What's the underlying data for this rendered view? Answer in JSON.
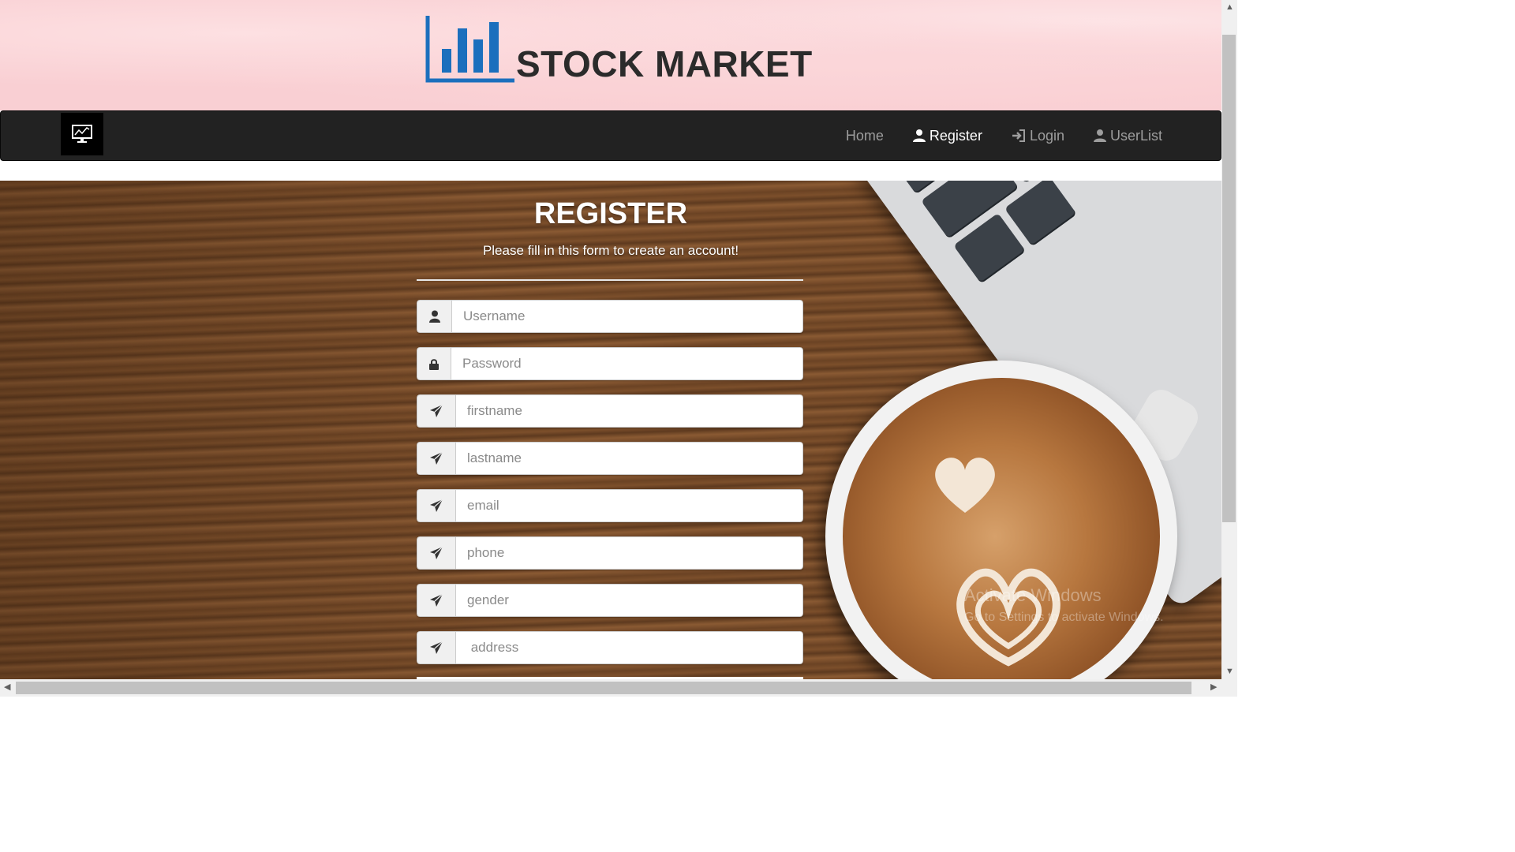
{
  "header": {
    "title": "STOCK MARKET"
  },
  "nav": {
    "items": [
      {
        "label": "Home",
        "icon": ""
      },
      {
        "label": "Register",
        "icon": "user-icon"
      },
      {
        "label": "Login",
        "icon": "login-icon"
      },
      {
        "label": "UserList",
        "icon": "user-icon"
      }
    ],
    "active": "Register"
  },
  "form": {
    "title": "REGISTER",
    "subtitle": "Please fill in this form to create an account!",
    "fields": [
      {
        "placeholder": "Username",
        "icon": "user-icon"
      },
      {
        "placeholder": "Password",
        "icon": "lock-icon"
      },
      {
        "placeholder": "firstname",
        "icon": "paper-plane-icon"
      },
      {
        "placeholder": "lastname",
        "icon": "paper-plane-icon"
      },
      {
        "placeholder": "email",
        "icon": "paper-plane-icon"
      },
      {
        "placeholder": "phone",
        "icon": "paper-plane-icon"
      },
      {
        "placeholder": "gender",
        "icon": "paper-plane-icon"
      },
      {
        "placeholder": " address",
        "icon": "paper-plane-icon"
      }
    ]
  },
  "watermark": {
    "line1": "Activate Windows",
    "line2": "Go to Settings to activate Windows."
  },
  "colors": {
    "banner": "#f9cfd3",
    "navbar": "#222222",
    "logo_blue": "#1b6fbd"
  }
}
